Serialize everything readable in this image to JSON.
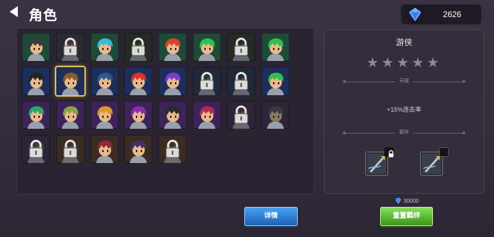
{
  "header": {
    "title": "角色",
    "currency": {
      "icon": "blue-gem-icon",
      "amount": "2626"
    }
  },
  "roster": {
    "selected_index": 9,
    "cells": [
      {
        "bg": "#1f4a38",
        "hair": "#3a3a3a",
        "skin": "#e9b98e",
        "locked": false
      },
      {
        "bg": "#2b2a33",
        "hair": "#6a2d2d",
        "skin": "#9a8070",
        "locked": true
      },
      {
        "bg": "#1f4a38",
        "hair": "#3fb6d6",
        "skin": "#e9b98e",
        "locked": false
      },
      {
        "bg": "#242a24",
        "hair": "#2c3020",
        "skin": "#8a7a60",
        "locked": true
      },
      {
        "bg": "#1f4a38",
        "hair": "#d8442a",
        "skin": "#e9b98e",
        "locked": false
      },
      {
        "bg": "#1f4a38",
        "hair": "#2fc24a",
        "skin": "#e9b98e",
        "locked": false
      },
      {
        "bg": "#242a24",
        "hair": "#2c2c2c",
        "skin": "#8a7a60",
        "locked": true
      },
      {
        "bg": "#1f4a38",
        "hair": "#2fc24a",
        "skin": "#e9b98e",
        "locked": false
      },
      {
        "bg": "#1e2e5a",
        "hair": "#222222",
        "skin": "#e9b98e",
        "locked": false
      },
      {
        "bg": "#1e2e5a",
        "hair": "#8a5a2a",
        "skin": "#e9b98e",
        "locked": false
      },
      {
        "bg": "#1e2e5a",
        "hair": "#2f5a8a",
        "skin": "#e9b98e",
        "locked": false
      },
      {
        "bg": "#1e2e5a",
        "hair": "#d8342a",
        "skin": "#e9b98e",
        "locked": false
      },
      {
        "bg": "#1e2e5a",
        "hair": "#7a3ad0",
        "skin": "#e9b98e",
        "locked": false
      },
      {
        "bg": "#20283a",
        "hair": "#2a4a2a",
        "skin": "#8a7a60",
        "locked": true
      },
      {
        "bg": "#20283a",
        "hair": "#2c2c2c",
        "skin": "#8a7a60",
        "locked": true
      },
      {
        "bg": "#1e2e5a",
        "hair": "#2fc24a",
        "skin": "#e9b98e",
        "locked": false
      },
      {
        "bg": "#3d2458",
        "hair": "#2aa86a",
        "skin": "#e9b98e",
        "locked": false
      },
      {
        "bg": "#3d2458",
        "hair": "#8aa04a",
        "skin": "#e9b98e",
        "locked": false
      },
      {
        "bg": "#3d2458",
        "hair": "#d89a2a",
        "skin": "#e9b98e",
        "locked": false
      },
      {
        "bg": "#3d2458",
        "hair": "#8a2ab0",
        "skin": "#e9b98e",
        "locked": false
      },
      {
        "bg": "#3d2458",
        "hair": "#2a2a2a",
        "skin": "#e9b98e",
        "locked": false
      },
      {
        "bg": "#3d2458",
        "hair": "#b02a5a",
        "skin": "#e9b98e",
        "locked": false
      },
      {
        "bg": "#2e2438",
        "hair": "#5a2a2a",
        "skin": "#8a7a60",
        "locked": true
      },
      {
        "bg": "#2e2438",
        "hair": "#3a3a3a",
        "skin": "#8a7a60",
        "locked": false
      },
      {
        "bg": "#2e2438",
        "hair": "#3a5a2a",
        "skin": "#8a7a60",
        "locked": true
      },
      {
        "bg": "#3a2c22",
        "hair": "#3a3a3a",
        "skin": "#8a7a60",
        "locked": true
      },
      {
        "bg": "#3a2c22",
        "hair": "#8a2a3a",
        "skin": "#e9b98e",
        "locked": false
      },
      {
        "bg": "#3a2c22",
        "hair": "#4a2a6a",
        "skin": "#e9b98e",
        "locked": false
      },
      {
        "bg": "#3a2c22",
        "hair": "#3a3a2a",
        "skin": "#8a7a60",
        "locked": true
      }
    ]
  },
  "info": {
    "name": "游侠",
    "stars_total": 5,
    "stars_filled": 0,
    "talent_label": "天赋",
    "talent_text": "+15%连击率",
    "bond_label": "羁绊",
    "bond_slots": [
      {
        "icon": "weapon-icon",
        "locked": true
      },
      {
        "icon": "weapon-icon",
        "locked": false
      }
    ]
  },
  "cost": {
    "icon": "blue-gem-icon",
    "amount": "30000"
  },
  "buttons": {
    "detail": "详情",
    "reset_bond": "重置羁绊"
  }
}
